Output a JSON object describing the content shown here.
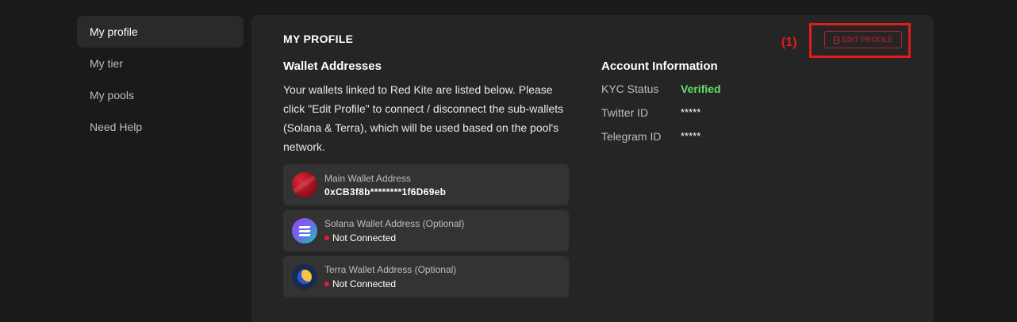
{
  "sidebar": {
    "items": [
      {
        "label": "My profile",
        "active": true
      },
      {
        "label": "My tier"
      },
      {
        "label": "My pools"
      },
      {
        "label": "Need Help"
      }
    ]
  },
  "profile": {
    "title": "MY PROFILE",
    "annotation": "(1)",
    "edit_button": "EDIT PROFILE"
  },
  "wallets": {
    "heading": "Wallet Addresses",
    "description": "Your wallets linked to Red Kite are listed below. Please click \"Edit Profile\" to connect / disconnect the sub-wallets (Solana & Terra), which will be used based on the pool's network.",
    "main": {
      "label": "Main Wallet Address",
      "value": "0xCB3f8b********1f6D69eb"
    },
    "solana": {
      "label": "Solana Wallet Address (Optional)",
      "status": "Not Connected"
    },
    "terra": {
      "label": "Terra Wallet Address (Optional)",
      "status": "Not Connected"
    }
  },
  "account": {
    "heading": "Account Information",
    "rows": [
      {
        "key": "KYC Status",
        "value": "Verified"
      },
      {
        "key": "Twitter ID",
        "value": "*****"
      },
      {
        "key": "Telegram ID",
        "value": "*****"
      }
    ]
  },
  "colors": {
    "accent_red": "#e31b1b",
    "verified_green": "#5fe36b",
    "panel_bg": "#252525",
    "page_bg": "#1a1a1a"
  }
}
